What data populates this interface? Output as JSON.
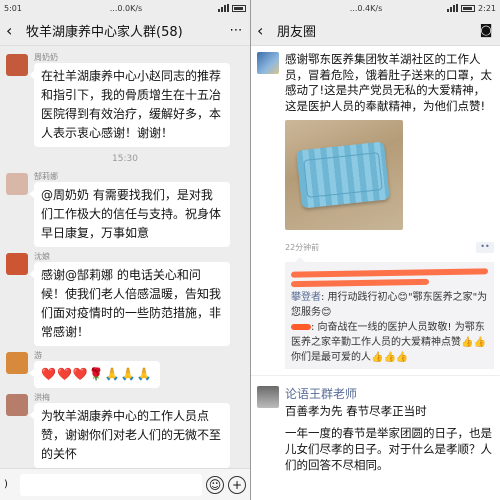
{
  "left": {
    "statusbar": {
      "time": "5:01",
      "center": "...0.0K/s",
      "right_time": ""
    },
    "title": "牧羊湖康养中心家人群(58)",
    "more_icon": "more-icon",
    "messages": [
      {
        "sender": "周奶奶",
        "avatar_color": "#c45a3c",
        "text": "在社羊湖康养中心小赵同志的推荐和指引下，我的骨质增生在十五冶医院得到有效治疗，缓解好多，本人表示衷心感谢！谢谢！"
      },
      {
        "timestamp": "15:30"
      },
      {
        "sender": "郜莉娜",
        "avatar_color": "#d9b7a8",
        "text": "@周奶奶 有需要找我们，是对我们工作极大的信任与支持。祝身体早日康复，万事如意"
      },
      {
        "sender": "沈娘",
        "avatar_color": "#cc5533",
        "text": "感谢@郜莉娜  的电话关心和问候！使我们老人倍感温暖，告知我们面对疫情时的一些防范措施，非常感谢！"
      },
      {
        "sender": "游",
        "avatar_color": "#d88a3c",
        "text": "❤️❤️❤️🌹🙏🙏🙏"
      },
      {
        "sender": "洪梅",
        "avatar_color": "#b57d6a",
        "text": "为牧羊湖康养中心的工作人员点赞，谢谢你们对老人们的无微不至的关怀"
      }
    ],
    "input": {
      "voice_icon": "voice-icon",
      "emoji_icon": "emoji-icon",
      "plus_icon": "plus-icon"
    }
  },
  "right": {
    "statusbar": {
      "time": "",
      "center": "...0.4K/s",
      "right_time": "2:21"
    },
    "title": "朋友圈",
    "camera_icon": "camera-icon",
    "post1": {
      "text": "感谢鄂东医养集团牧羊湖社区的工作人员，冒着危险，饿着肚子送来的口罩，太感动了!这是共产党员无私的大爱精神，这是医护人员的奉献精神，为他们点赞!",
      "time": "22分钟前",
      "comments": [
        {
          "name": "攀登者",
          "text": ": 用行动践行初心😊\"鄂东医养之家\"为您服务😊"
        },
        {
          "name": "",
          "text": ": 向奋战在一线的医护人员致敬! 为鄂东医养之家辛勤工作人员的大爱精神点赞👍👍你们是最可爱的人👍👍👍"
        }
      ]
    },
    "post2": {
      "name": "论语王群老师",
      "line1": "百善孝为先 春节尽孝正当时",
      "para": "一年一度的春节是举家团圆的日子，也是儿女们尽孝的日子。对于什么是孝顺？人们的回答不尽相同。"
    }
  }
}
